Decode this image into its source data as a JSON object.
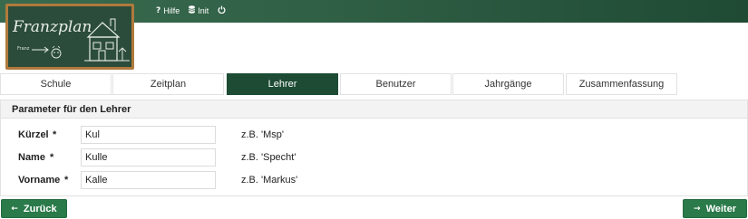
{
  "topnav": {
    "items": [
      {
        "icon": "question-icon",
        "label": "Hilfe"
      },
      {
        "icon": "database-icon",
        "label": "Init"
      },
      {
        "icon": "power-icon",
        "label": ""
      }
    ]
  },
  "logo": {
    "text": "Franzplan",
    "small_text": "Franz"
  },
  "tabs": [
    {
      "label": "Schule",
      "active": false
    },
    {
      "label": "Zeitplan",
      "active": false
    },
    {
      "label": "Lehrer",
      "active": true
    },
    {
      "label": "Benutzer",
      "active": false
    },
    {
      "label": "Jahrgänge",
      "active": false
    },
    {
      "label": "Zusammenfassung",
      "active": false
    }
  ],
  "panel": {
    "title": "Parameter für den Lehrer",
    "fields": [
      {
        "label": "Kürzel",
        "required": "*",
        "value": "Kul",
        "hint": "z.B. 'Msp'"
      },
      {
        "label": "Name",
        "required": "*",
        "value": "Kulle",
        "hint": "z.B. 'Specht'"
      },
      {
        "label": "Vorname",
        "required": "*",
        "value": "Kalle",
        "hint": "z.B. 'Markus'"
      }
    ]
  },
  "buttons": {
    "back": "Zurück",
    "next": "Weiter"
  },
  "colors": {
    "accent": "#1d4b34",
    "button": "#2a7a4a",
    "frame": "#b07a3c"
  }
}
